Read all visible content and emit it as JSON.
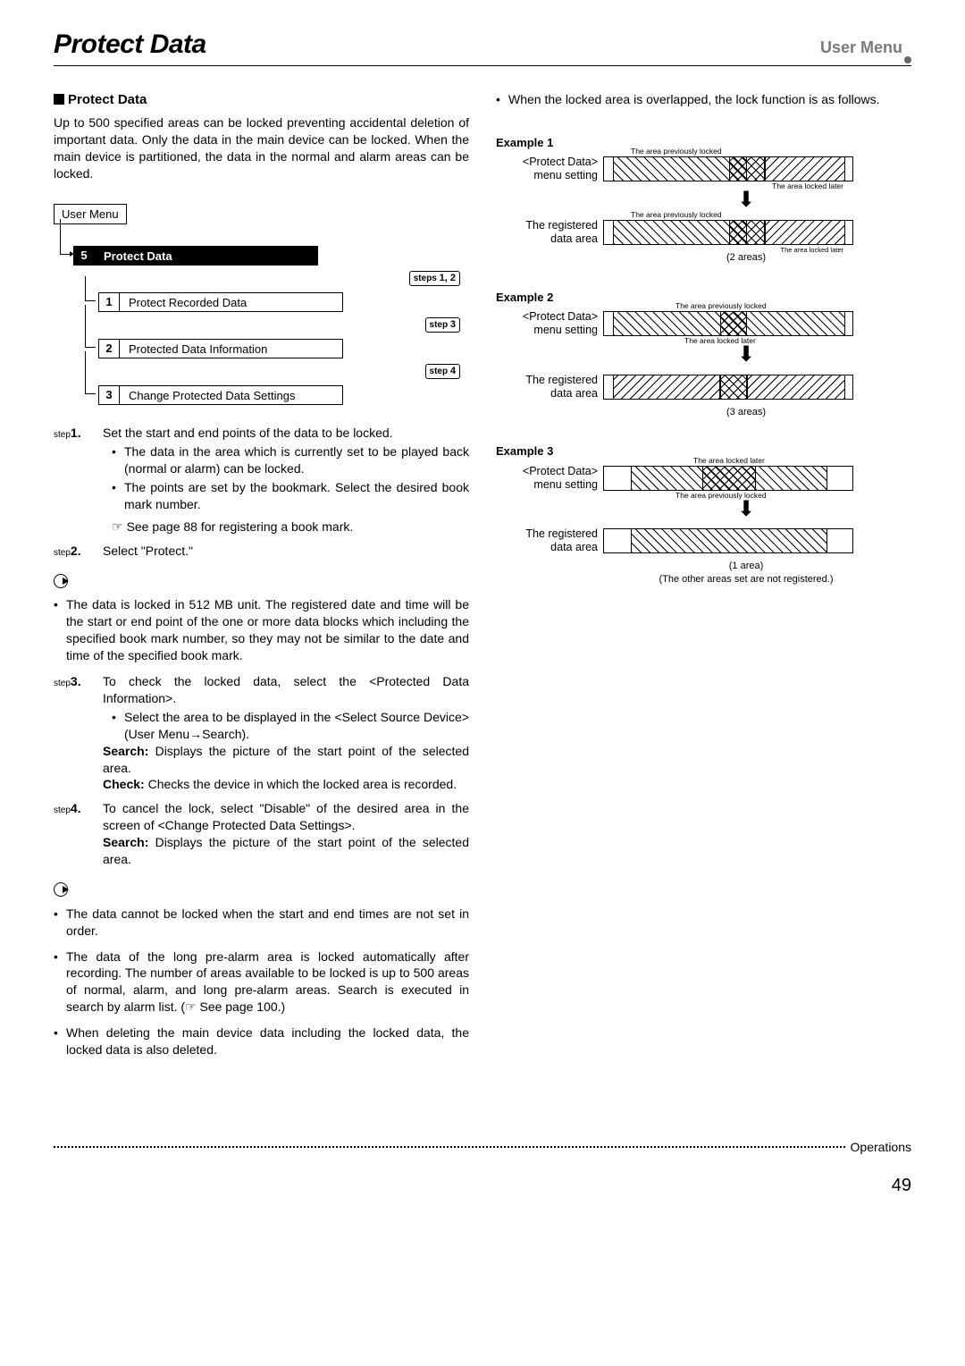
{
  "header": {
    "title": "Protect Data",
    "right": "User Menu"
  },
  "section": {
    "heading": "Protect Data",
    "intro": "Up to 500 specified areas can be locked preventing accidental deletion of important data. Only the data in the main device can be locked. When the main device is partitioned, the data in the normal and alarm areas can be locked."
  },
  "menu": {
    "root": "User Menu",
    "main_num": "5",
    "main_label": "Protect Data",
    "tag12": "steps 1, 2",
    "tag3": "step 3",
    "tag4": "step 4",
    "items": [
      {
        "num": "1",
        "label": "Protect Recorded Data"
      },
      {
        "num": "2",
        "label": "Protected Data Information"
      },
      {
        "num": "3",
        "label": "Change Protected Data Settings"
      }
    ]
  },
  "steps": {
    "s1": {
      "label": "step1.",
      "text": "Set the start and end points of the data to be locked.",
      "b1": "The data in the area which is currently set to be played back (normal or alarm) can be locked.",
      "b2": "The points are set by the bookmark. Select the desired book mark number.",
      "see": "See page 88 for registering a book mark."
    },
    "s2": {
      "label": "step2.",
      "text": "Select \"Protect.\""
    },
    "note1": "The data is locked in 512 MB unit. The registered date and time will be the start or end point of the one or more data blocks which including the specified book mark number, so they may not be similar to the date and time of the specified book mark.",
    "s3": {
      "label": "step3.",
      "text": "To check the locked data, select the <Protected Data Information>.",
      "b1": "Select the area to be displayed in the <Select Source Device> (User Menu→Search).",
      "search": "Search:",
      "search_t": " Displays the picture of the start point of the selected area.",
      "check": "Check:",
      "check_t": " Checks the device in which the locked area is recorded."
    },
    "s4": {
      "label": "step4.",
      "text": "To cancel the lock, select \"Disable\" of the desired area in the screen of <Change Protected Data Settings>.",
      "search": "Search:",
      "search_t": " Displays the picture of the start point of the selected area."
    },
    "notes": [
      "The data cannot be locked when the start and end times are not set in order.",
      "The data of the long pre-alarm area is locked automatically after recording. The number of areas available to be locked is up to 500 areas of normal, alarm, and long pre-alarm areas. Search is executed in search by alarm list. (☞ See page 100.)",
      "When deleting the main device data including the locked data, the locked data is also deleted."
    ]
  },
  "right": {
    "intro": "When the locked area is overlapped, the lock function is as follows.",
    "ex": [
      {
        "title": "Example 1",
        "row1": "<Protect Data>\nmenu setting",
        "row2": "The registered\ndata area",
        "ann_prev": "The area previously locked",
        "ann_later": "The area locked later",
        "areas": "(2 areas)"
      },
      {
        "title": "Example 2",
        "row1": "<Protect Data>\nmenu setting",
        "row2": "The registered\ndata area",
        "ann_prev": "The area previously locked",
        "ann_later": "The area locked later",
        "areas": "(3 areas)"
      },
      {
        "title": "Example 3",
        "row1": "<Protect Data>\nmenu setting",
        "row2": "The registered\ndata area",
        "ann_prev": "The area previously locked",
        "ann_later": "The area locked later",
        "areas": "(1 area)",
        "extra": "(The other areas set are not registered.)"
      }
    ]
  },
  "footer": {
    "ops": "Operations",
    "page": "49"
  }
}
